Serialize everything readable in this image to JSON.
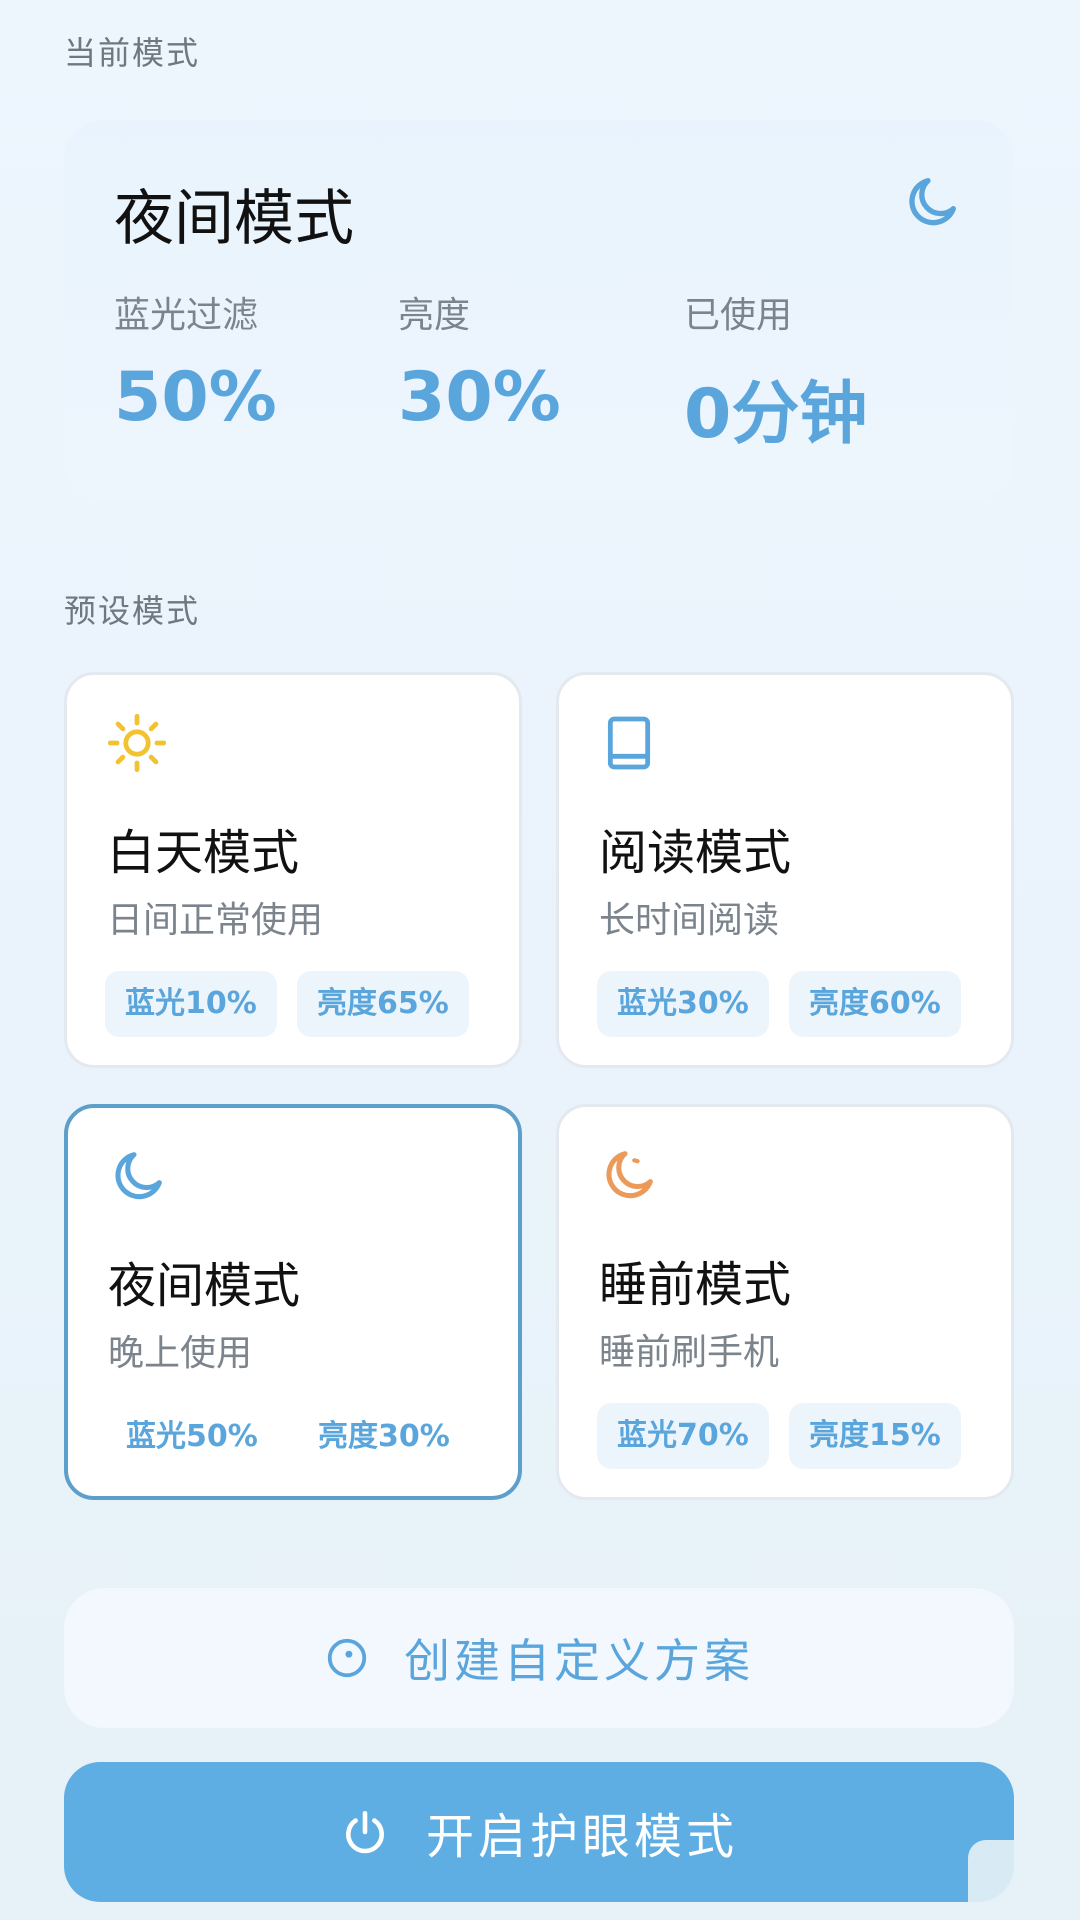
{
  "current": {
    "section_label": "当前模式",
    "title": "夜间模式",
    "icon": "moon-icon",
    "stats": [
      {
        "label": "蓝光过滤",
        "value": "50%"
      },
      {
        "label": "亮度",
        "value": "30%"
      },
      {
        "label": "已使用",
        "value": "0分钟"
      }
    ]
  },
  "presets": {
    "section_label": "预设模式",
    "modes": [
      {
        "icon": "sun-icon",
        "title": "白天模式",
        "subtitle": "日间正常使用",
        "blue": "蓝光10%",
        "brightness": "亮度65%",
        "selected": false
      },
      {
        "icon": "book-icon",
        "title": "阅读模式",
        "subtitle": "长时间阅读",
        "blue": "蓝光30%",
        "brightness": "亮度60%",
        "selected": false
      },
      {
        "icon": "moon-icon",
        "title": "夜间模式",
        "subtitle": "晚上使用",
        "blue": "蓝光50%",
        "brightness": "亮度30%",
        "selected": true
      },
      {
        "icon": "moon-orange-icon",
        "title": "睡前模式",
        "subtitle": "睡前刷手机",
        "blue": "蓝光70%",
        "brightness": "亮度15%",
        "selected": false
      }
    ]
  },
  "actions": {
    "custom_label": "创建自定义方案",
    "primary_label": "开启护眼模式"
  },
  "colors": {
    "accent": "#5aa6dc",
    "primary_button": "#5faee3",
    "active_border": "#5d9fcb",
    "sun": "#f2c230",
    "sleep_moon": "#ec9a5a"
  }
}
